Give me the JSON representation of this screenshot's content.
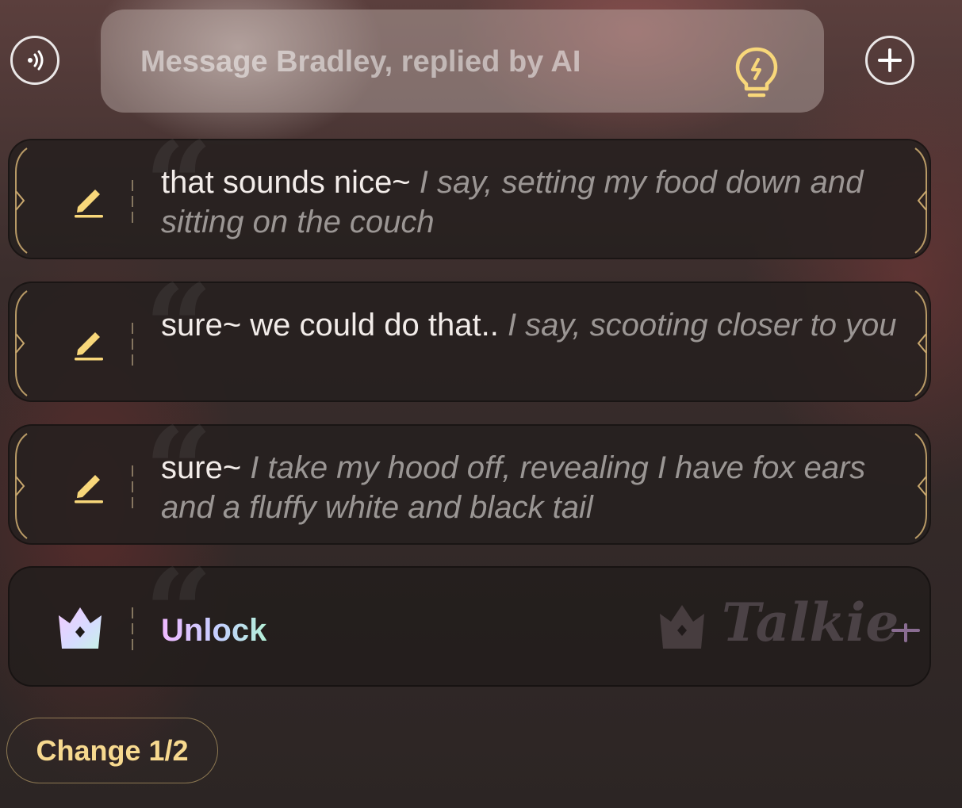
{
  "composer": {
    "placeholder": "Message Bradley, replied by AI",
    "voice_icon": "voice-wave-icon",
    "hint_icon": "lightbulb-icon",
    "add_icon": "plus-circle-icon"
  },
  "suggestions": [
    {
      "speech": "that sounds nice~ ",
      "action": "I say, setting my food down and sitting on the couch",
      "edit_icon": "pencil-icon"
    },
    {
      "speech": "sure~ we could do that.. ",
      "action": "I say, scooting closer to you",
      "edit_icon": "pencil-icon"
    },
    {
      "speech": "sure~ ",
      "action": "I take my hood off, revealing I have fox ears and a fluffy white and black tail",
      "edit_icon": "pencil-icon"
    }
  ],
  "unlock": {
    "label": "Unlock",
    "crown_icon": "crown-icon",
    "brand": "Talkie",
    "brand_suffix_icon": "plus-sparkle-icon"
  },
  "change_button": {
    "label": "Change 1/2"
  },
  "colors": {
    "accent_gold": "#f7d98f",
    "icon_yellow": "#f8d77a",
    "card_bg": "#26201f"
  }
}
